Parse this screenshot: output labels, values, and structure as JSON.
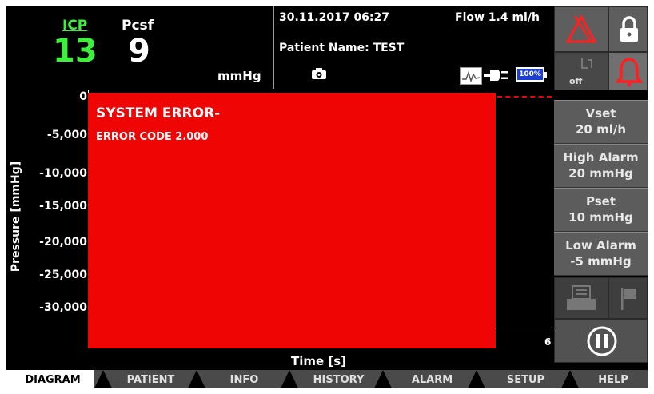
{
  "header": {
    "icp_label": "ICP",
    "icp_value": "13",
    "pcsf_label": "Pcsf",
    "pcsf_value": "9",
    "unit": "mmHg",
    "datetime": "30.11.2017 06:27",
    "flow": "Flow 1.4 ml/h",
    "patient": "Patient Name: TEST",
    "battery": "100%"
  },
  "colors": {
    "icp": "#3df03d",
    "error": "#f00505",
    "alarm_red": "#ff1a1a"
  },
  "controls": {
    "mute_alarm_icon": "alarm-off-triangle-icon",
    "lock_icon": "lock-icon",
    "off_label": "off",
    "bell_icon": "alarm-bell-icon",
    "print_icon": "printer-icon",
    "flag_icon": "flag-icon",
    "pause_icon": "pause-icon"
  },
  "params": [
    {
      "name": "Vset",
      "value": "20 ml/h"
    },
    {
      "name": "High Alarm",
      "value": "20 mmHg"
    },
    {
      "name": "Pset",
      "value": "10 mmHg"
    },
    {
      "name": "Low Alarm",
      "value": "-5 mmHg"
    }
  ],
  "chart": {
    "ylabel": "Pressure [mmHg]",
    "xlabel": "Time [s]",
    "yticks": [
      "0",
      "-5,000",
      "-10,000",
      "-15,000",
      "-20,000",
      "-25,000",
      "-30,000"
    ],
    "xtick_visible": "6"
  },
  "error": {
    "title": "SYSTEM ERROR-",
    "code": "ERROR CODE 2.000"
  },
  "tabs": [
    "DIAGRAM",
    "PATIENT",
    "INFO",
    "HISTORY",
    "ALARM",
    "SETUP",
    "HELP"
  ]
}
